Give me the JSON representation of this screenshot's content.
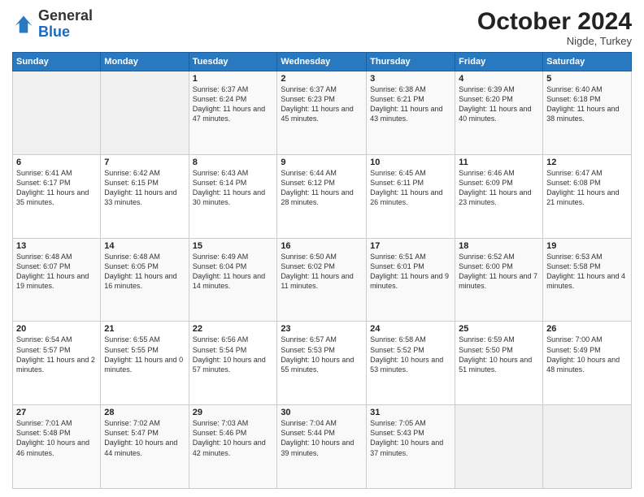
{
  "header": {
    "logo_general": "General",
    "logo_blue": "Blue",
    "month_year": "October 2024",
    "location": "Nigde, Turkey"
  },
  "weekdays": [
    "Sunday",
    "Monday",
    "Tuesday",
    "Wednesday",
    "Thursday",
    "Friday",
    "Saturday"
  ],
  "weeks": [
    [
      {
        "day": "",
        "sunrise": "",
        "sunset": "",
        "daylight": ""
      },
      {
        "day": "",
        "sunrise": "",
        "sunset": "",
        "daylight": ""
      },
      {
        "day": "1",
        "sunrise": "Sunrise: 6:37 AM",
        "sunset": "Sunset: 6:24 PM",
        "daylight": "Daylight: 11 hours and 47 minutes."
      },
      {
        "day": "2",
        "sunrise": "Sunrise: 6:37 AM",
        "sunset": "Sunset: 6:23 PM",
        "daylight": "Daylight: 11 hours and 45 minutes."
      },
      {
        "day": "3",
        "sunrise": "Sunrise: 6:38 AM",
        "sunset": "Sunset: 6:21 PM",
        "daylight": "Daylight: 11 hours and 43 minutes."
      },
      {
        "day": "4",
        "sunrise": "Sunrise: 6:39 AM",
        "sunset": "Sunset: 6:20 PM",
        "daylight": "Daylight: 11 hours and 40 minutes."
      },
      {
        "day": "5",
        "sunrise": "Sunrise: 6:40 AM",
        "sunset": "Sunset: 6:18 PM",
        "daylight": "Daylight: 11 hours and 38 minutes."
      }
    ],
    [
      {
        "day": "6",
        "sunrise": "Sunrise: 6:41 AM",
        "sunset": "Sunset: 6:17 PM",
        "daylight": "Daylight: 11 hours and 35 minutes."
      },
      {
        "day": "7",
        "sunrise": "Sunrise: 6:42 AM",
        "sunset": "Sunset: 6:15 PM",
        "daylight": "Daylight: 11 hours and 33 minutes."
      },
      {
        "day": "8",
        "sunrise": "Sunrise: 6:43 AM",
        "sunset": "Sunset: 6:14 PM",
        "daylight": "Daylight: 11 hours and 30 minutes."
      },
      {
        "day": "9",
        "sunrise": "Sunrise: 6:44 AM",
        "sunset": "Sunset: 6:12 PM",
        "daylight": "Daylight: 11 hours and 28 minutes."
      },
      {
        "day": "10",
        "sunrise": "Sunrise: 6:45 AM",
        "sunset": "Sunset: 6:11 PM",
        "daylight": "Daylight: 11 hours and 26 minutes."
      },
      {
        "day": "11",
        "sunrise": "Sunrise: 6:46 AM",
        "sunset": "Sunset: 6:09 PM",
        "daylight": "Daylight: 11 hours and 23 minutes."
      },
      {
        "day": "12",
        "sunrise": "Sunrise: 6:47 AM",
        "sunset": "Sunset: 6:08 PM",
        "daylight": "Daylight: 11 hours and 21 minutes."
      }
    ],
    [
      {
        "day": "13",
        "sunrise": "Sunrise: 6:48 AM",
        "sunset": "Sunset: 6:07 PM",
        "daylight": "Daylight: 11 hours and 19 minutes."
      },
      {
        "day": "14",
        "sunrise": "Sunrise: 6:48 AM",
        "sunset": "Sunset: 6:05 PM",
        "daylight": "Daylight: 11 hours and 16 minutes."
      },
      {
        "day": "15",
        "sunrise": "Sunrise: 6:49 AM",
        "sunset": "Sunset: 6:04 PM",
        "daylight": "Daylight: 11 hours and 14 minutes."
      },
      {
        "day": "16",
        "sunrise": "Sunrise: 6:50 AM",
        "sunset": "Sunset: 6:02 PM",
        "daylight": "Daylight: 11 hours and 11 minutes."
      },
      {
        "day": "17",
        "sunrise": "Sunrise: 6:51 AM",
        "sunset": "Sunset: 6:01 PM",
        "daylight": "Daylight: 11 hours and 9 minutes."
      },
      {
        "day": "18",
        "sunrise": "Sunrise: 6:52 AM",
        "sunset": "Sunset: 6:00 PM",
        "daylight": "Daylight: 11 hours and 7 minutes."
      },
      {
        "day": "19",
        "sunrise": "Sunrise: 6:53 AM",
        "sunset": "Sunset: 5:58 PM",
        "daylight": "Daylight: 11 hours and 4 minutes."
      }
    ],
    [
      {
        "day": "20",
        "sunrise": "Sunrise: 6:54 AM",
        "sunset": "Sunset: 5:57 PM",
        "daylight": "Daylight: 11 hours and 2 minutes."
      },
      {
        "day": "21",
        "sunrise": "Sunrise: 6:55 AM",
        "sunset": "Sunset: 5:55 PM",
        "daylight": "Daylight: 11 hours and 0 minutes."
      },
      {
        "day": "22",
        "sunrise": "Sunrise: 6:56 AM",
        "sunset": "Sunset: 5:54 PM",
        "daylight": "Daylight: 10 hours and 57 minutes."
      },
      {
        "day": "23",
        "sunrise": "Sunrise: 6:57 AM",
        "sunset": "Sunset: 5:53 PM",
        "daylight": "Daylight: 10 hours and 55 minutes."
      },
      {
        "day": "24",
        "sunrise": "Sunrise: 6:58 AM",
        "sunset": "Sunset: 5:52 PM",
        "daylight": "Daylight: 10 hours and 53 minutes."
      },
      {
        "day": "25",
        "sunrise": "Sunrise: 6:59 AM",
        "sunset": "Sunset: 5:50 PM",
        "daylight": "Daylight: 10 hours and 51 minutes."
      },
      {
        "day": "26",
        "sunrise": "Sunrise: 7:00 AM",
        "sunset": "Sunset: 5:49 PM",
        "daylight": "Daylight: 10 hours and 48 minutes."
      }
    ],
    [
      {
        "day": "27",
        "sunrise": "Sunrise: 7:01 AM",
        "sunset": "Sunset: 5:48 PM",
        "daylight": "Daylight: 10 hours and 46 minutes."
      },
      {
        "day": "28",
        "sunrise": "Sunrise: 7:02 AM",
        "sunset": "Sunset: 5:47 PM",
        "daylight": "Daylight: 10 hours and 44 minutes."
      },
      {
        "day": "29",
        "sunrise": "Sunrise: 7:03 AM",
        "sunset": "Sunset: 5:46 PM",
        "daylight": "Daylight: 10 hours and 42 minutes."
      },
      {
        "day": "30",
        "sunrise": "Sunrise: 7:04 AM",
        "sunset": "Sunset: 5:44 PM",
        "daylight": "Daylight: 10 hours and 39 minutes."
      },
      {
        "day": "31",
        "sunrise": "Sunrise: 7:05 AM",
        "sunset": "Sunset: 5:43 PM",
        "daylight": "Daylight: 10 hours and 37 minutes."
      },
      {
        "day": "",
        "sunrise": "",
        "sunset": "",
        "daylight": ""
      },
      {
        "day": "",
        "sunrise": "",
        "sunset": "",
        "daylight": ""
      }
    ]
  ]
}
